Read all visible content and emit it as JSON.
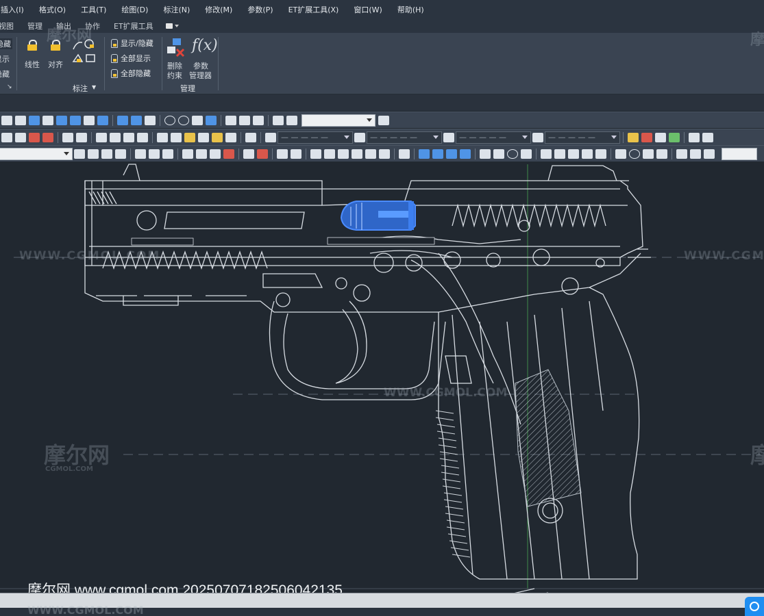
{
  "menu": [
    "插入(I)",
    "格式(O)",
    "工具(T)",
    "绘图(D)",
    "标注(N)",
    "修改(M)",
    "参数(P)",
    "ET扩展工具(X)",
    "窗口(W)",
    "帮助(H)"
  ],
  "tabs": [
    "视图",
    "管理",
    "输出",
    "协作",
    "ET扩展工具"
  ],
  "ribbon": {
    "left_partial": [
      "隐藏",
      "显示",
      "隐藏"
    ],
    "linear_label": "线性",
    "align_label": "对齐",
    "show_hide": "显示/隐藏",
    "show_all": "全部显示",
    "hide_all": "全部隐藏",
    "dimension_group": "标注",
    "delete_constraint": "删除\n约束",
    "delete_label_1": "删除",
    "delete_label_2": "约束",
    "param_label_1": "参数",
    "param_label_2": "管理器",
    "fx": "f(x)",
    "manage_group": "管理"
  },
  "toolbar": {
    "combo1": "",
    "combo2": "— — — — —",
    "combo3": "— — — — —",
    "combo4": "— — — — —",
    "combo5": "— — — — —"
  },
  "watermarks": {
    "site_cn": "摩尔网",
    "site_en": "WWW.CGMOL.COM",
    "site_short": "CGMOL.COM",
    "caption": "摩尔网 www.cgmol.com 20250707182506042135"
  },
  "colors": {
    "canvas_bg": "#212830",
    "ribbon_bg": "#3a4452",
    "highlight": "#3d7ff0",
    "linework": "#d8dde3"
  }
}
